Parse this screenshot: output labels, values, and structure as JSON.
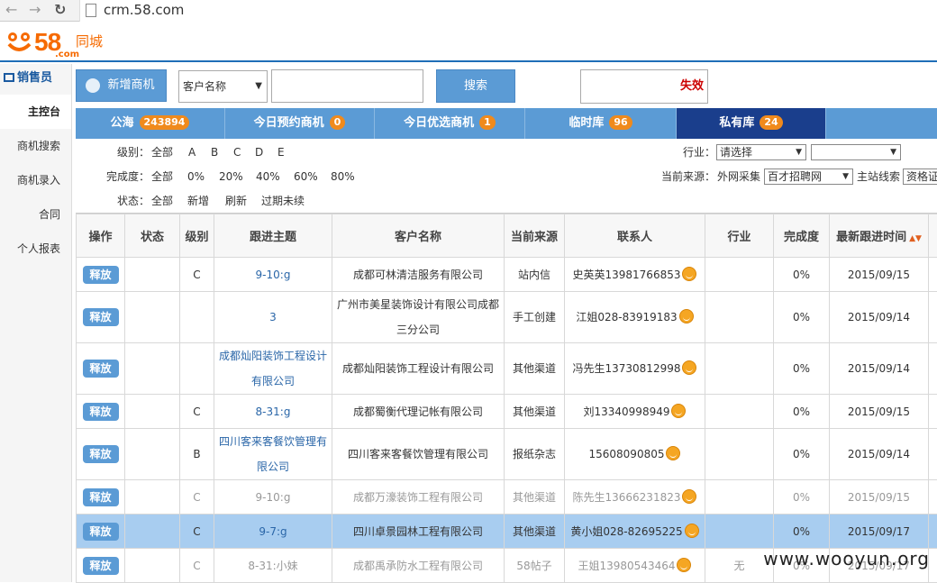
{
  "browser": {
    "url": "crm.58.com",
    "back_icon": "arrow-left-icon",
    "forward_icon": "arrow-right-icon",
    "reload_icon": "reload-icon"
  },
  "logo": {
    "number": "58",
    "domain": ".com",
    "city": "同城"
  },
  "sidebar": {
    "header": "销售员",
    "items": [
      {
        "label": "主控台",
        "active": true
      },
      {
        "label": "商机搜索",
        "active": false
      },
      {
        "label": "商机录入",
        "active": false
      },
      {
        "label": "合同",
        "active": false
      },
      {
        "label": "个人报表",
        "active": false
      }
    ]
  },
  "toolbar": {
    "new_label": "新增商机",
    "search_field_select": "客户名称",
    "search_value": "",
    "search_label": "搜索",
    "fail_text": "失效"
  },
  "tabs": [
    {
      "label": "公海",
      "count": "243894",
      "active": false
    },
    {
      "label": "今日预约商机",
      "count": "0",
      "active": false
    },
    {
      "label": "今日优选商机",
      "count": "1",
      "active": false
    },
    {
      "label": "临时库",
      "count": "96",
      "active": false
    },
    {
      "label": "私有库",
      "count": "24",
      "active": true
    }
  ],
  "filters": {
    "level": {
      "label": "级别：",
      "options": [
        "全部",
        "A",
        "B",
        "C",
        "D",
        "E"
      ]
    },
    "industry": {
      "label": "行业：",
      "value": "请选择",
      "sub_value": ""
    },
    "completeness": {
      "label": "完成度：",
      "options": [
        "全部",
        "0%",
        "20%",
        "40%",
        "60%",
        "80%"
      ]
    },
    "source": {
      "label": "当前来源：",
      "kind": "外网采集",
      "value": "百才招聘网",
      "station_label": "主站线索",
      "station_value": "资格证"
    },
    "status": {
      "label": "状态：",
      "options": [
        "全部",
        "新增",
        "刷新",
        "过期未续"
      ]
    }
  },
  "table": {
    "columns": [
      "操作",
      "状态",
      "级别",
      "跟进主题",
      "客户名称",
      "当前来源",
      "联系人",
      "行业",
      "完成度",
      "最新跟进时间",
      ""
    ],
    "release_label": "释放",
    "rows": [
      {
        "status": "",
        "level": "C",
        "topic": "9-10:g",
        "customer": "成都可林清洁服务有限公司",
        "source": "站内信",
        "contact": "史英英13981766853",
        "industry": "",
        "completeness": "0%",
        "last": "2015/09/15",
        "extra": "2",
        "style": "normal"
      },
      {
        "status": "",
        "level": "",
        "topic": "3",
        "customer": "广州市美星装饰设计有限公司成都三分公司",
        "source": "手工创建",
        "contact": "江姐028-83919183",
        "industry": "",
        "completeness": "0%",
        "last": "2015/09/14",
        "extra": "2",
        "style": "normal"
      },
      {
        "status": "",
        "level": "",
        "topic": "成都灿阳装饰工程设计有限公司",
        "customer": "成都灿阳装饰工程设计有限公司",
        "source": "其他渠道",
        "contact": "冯先生13730812998",
        "industry": "",
        "completeness": "0%",
        "last": "2015/09/14",
        "extra": "2",
        "style": "normal"
      },
      {
        "status": "",
        "level": "C",
        "topic": "8-31:g",
        "customer": "成都蜀衡代理记帐有限公司",
        "source": "其他渠道",
        "contact": "刘13340998949",
        "industry": "",
        "completeness": "0%",
        "last": "2015/09/15",
        "extra": "2",
        "style": "normal"
      },
      {
        "status": "",
        "level": "B",
        "topic": "四川客来客餐饮管理有限公司",
        "customer": "四川客来客餐饮管理有限公司",
        "source": "报纸杂志",
        "contact": "15608090805",
        "industry": "",
        "completeness": "0%",
        "last": "2015/09/14",
        "extra": "2",
        "style": "normal"
      },
      {
        "status": "",
        "level": "C",
        "topic": "9-10:g",
        "customer": "成都万濠装饰工程有限公司",
        "source": "其他渠道",
        "contact": "陈先生13666231823",
        "industry": "",
        "completeness": "0%",
        "last": "2015/09/15",
        "extra": "2",
        "style": "grey"
      },
      {
        "status": "",
        "level": "C",
        "topic": "9-7:g",
        "customer": "四川卓景园林工程有限公司",
        "source": "其他渠道",
        "contact": "黄小姐028-82695225",
        "industry": "",
        "completeness": "0%",
        "last": "2015/09/17",
        "extra": "2",
        "style": "sel"
      },
      {
        "status": "",
        "level": "C",
        "topic": "8-31:小妹",
        "customer": "成都禹承防水工程有限公司",
        "source": "58帖子",
        "contact": "王姐13980543464",
        "industry": "无",
        "completeness": "0%",
        "last": "2015/09/17",
        "extra": "2",
        "style": "grey"
      }
    ]
  },
  "watermark": "www.wooyun.org",
  "colors": {
    "accent": "#5b9bd5",
    "active_tab": "#1a3e8c",
    "badge": "#f08a1c",
    "logo": "#f66a00"
  }
}
